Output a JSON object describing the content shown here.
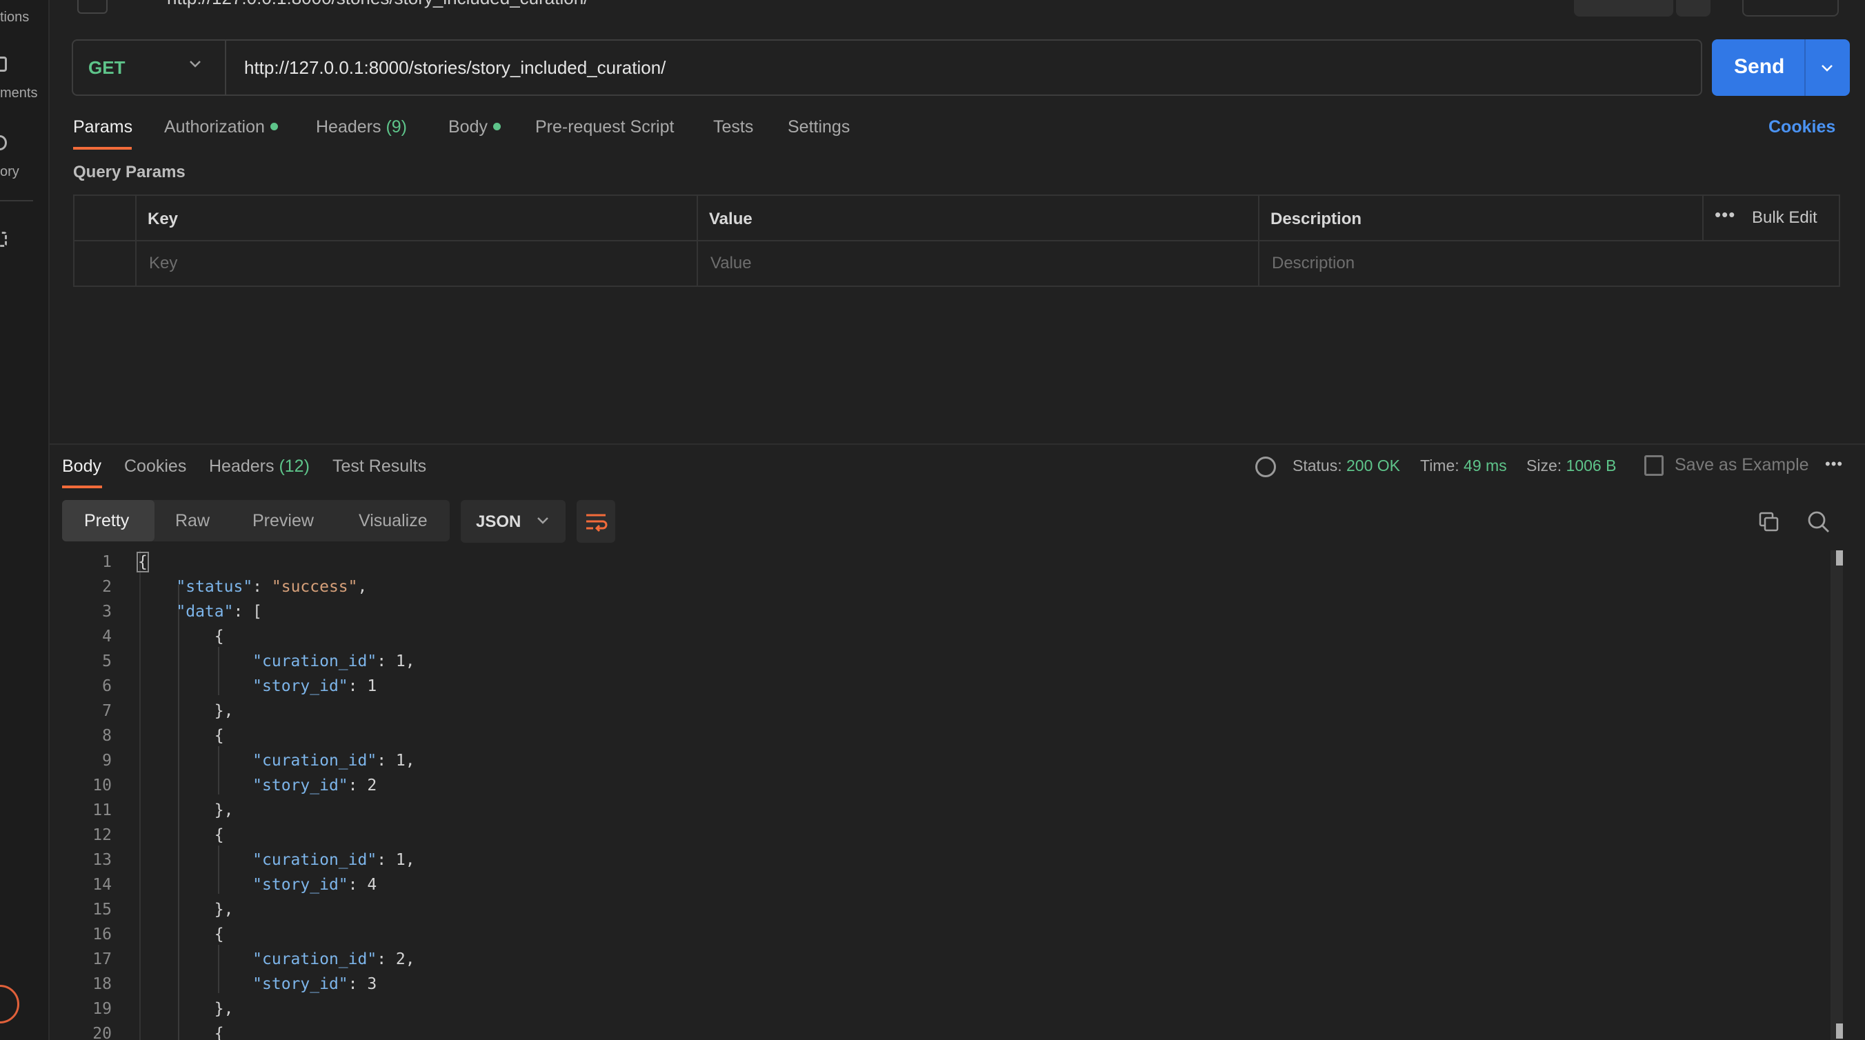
{
  "sidebar": {
    "items": [
      {
        "label": "tions"
      },
      {
        "label": "ments"
      },
      {
        "label": "ory"
      }
    ]
  },
  "top": {
    "url_partial": "http://127.0.0.1:8000/stories/story_included_curation/"
  },
  "request": {
    "method": "GET",
    "url": "http://127.0.0.1:8000/stories/story_included_curation/",
    "send_label": "Send"
  },
  "req_tabs": {
    "params": "Params",
    "authorization": "Authorization",
    "headers": "Headers",
    "headers_count": "(9)",
    "body": "Body",
    "prerequest": "Pre-request Script",
    "tests": "Tests",
    "settings": "Settings",
    "cookies": "Cookies"
  },
  "query_params": {
    "title": "Query Params",
    "columns": {
      "key": "Key",
      "value": "Value",
      "description": "Description"
    },
    "placeholders": {
      "key": "Key",
      "value": "Value",
      "description": "Description"
    },
    "bulk_edit": "Bulk Edit"
  },
  "response": {
    "tabs": {
      "body": "Body",
      "cookies": "Cookies",
      "headers": "Headers",
      "headers_count": "(12)",
      "test_results": "Test Results"
    },
    "status_label": "Status:",
    "status_value": "200 OK",
    "time_label": "Time:",
    "time_value": "49 ms",
    "size_label": "Size:",
    "size_value": "1006 B",
    "save_example": "Save as Example",
    "view_modes": {
      "pretty": "Pretty",
      "raw": "Raw",
      "preview": "Preview",
      "visualize": "Visualize"
    },
    "format": "JSON"
  },
  "code": {
    "line_numbers": [
      "1",
      "2",
      "3",
      "4",
      "5",
      "6",
      "7",
      "8",
      "9",
      "10",
      "11",
      "12",
      "13",
      "14",
      "15",
      "16",
      "17",
      "18",
      "19",
      "20"
    ],
    "status_key": "\"status\"",
    "status_value": "\"success\"",
    "data_key": "\"data\"",
    "curation_key": "\"curation_id\"",
    "story_key": "\"story_id\"",
    "items": [
      {
        "curation_id": "1",
        "story_id": "1"
      },
      {
        "curation_id": "1",
        "story_id": "2"
      },
      {
        "curation_id": "1",
        "story_id": "4"
      },
      {
        "curation_id": "2",
        "story_id": "3"
      }
    ]
  },
  "colors": {
    "accent": "#f26b3a",
    "send_button": "#3178e6",
    "success_green": "#5ec48a",
    "json_key": "#7db5ea",
    "json_string": "#d6a07a"
  }
}
